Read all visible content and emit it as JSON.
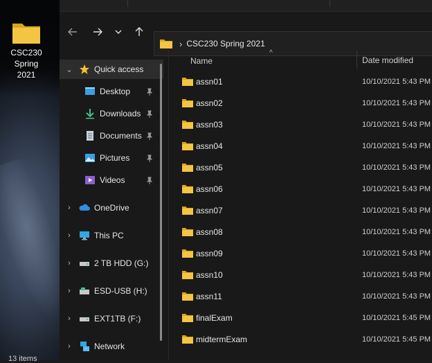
{
  "desktop": {
    "icon_label_line1": "CSC230",
    "icon_label_line2": "Spring 2021"
  },
  "address_bar": {
    "path": "CSC230 Spring 2021"
  },
  "nav_pane": {
    "quick_access": "Quick access",
    "quick_items": [
      "Desktop",
      "Downloads",
      "Documents",
      "Pictures",
      "Videos"
    ],
    "onedrive": "OneDrive",
    "this_pc": "This PC",
    "drives": [
      "2 TB HDD (G:)",
      "ESD-USB (H:)",
      "EXT1TB (F:)"
    ],
    "network": "Network"
  },
  "columns": {
    "name": "Name",
    "date_modified": "Date modified"
  },
  "files": [
    {
      "name": "assn01",
      "date": "10/10/2021 5:43 PM"
    },
    {
      "name": "assn02",
      "date": "10/10/2021 5:43 PM"
    },
    {
      "name": "assn03",
      "date": "10/10/2021 5:43 PM"
    },
    {
      "name": "assn04",
      "date": "10/10/2021 5:43 PM"
    },
    {
      "name": "assn05",
      "date": "10/10/2021 5:43 PM"
    },
    {
      "name": "assn06",
      "date": "10/10/2021 5:43 PM"
    },
    {
      "name": "assn07",
      "date": "10/10/2021 5:43 PM"
    },
    {
      "name": "assn08",
      "date": "10/10/2021 5:43 PM"
    },
    {
      "name": "assn09",
      "date": "10/10/2021 5:43 PM"
    },
    {
      "name": "assn10",
      "date": "10/10/2021 5:43 PM"
    },
    {
      "name": "assn11",
      "date": "10/10/2021 5:43 PM"
    },
    {
      "name": "finalExam",
      "date": "10/10/2021 5:45 PM"
    },
    {
      "name": "midtermExam",
      "date": "10/10/2021 5:45 PM"
    }
  ],
  "status_bar": {
    "item_count": "13 items"
  },
  "colors": {
    "folder": "#f4c542",
    "accent_star": "#f2c230",
    "window_bg": "#191919"
  }
}
